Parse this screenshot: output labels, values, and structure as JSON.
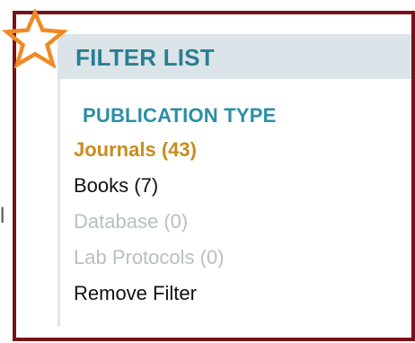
{
  "edge_glyph": "l",
  "filter_panel": {
    "title": "FILTER LIST",
    "section_heading": "PUBLICATION TYPE",
    "options": [
      {
        "label": "Journals",
        "count": "(43)",
        "state": "active"
      },
      {
        "label": "Books",
        "count": "(7)",
        "state": "normal"
      },
      {
        "label": "Database",
        "count": "(0)",
        "state": "disabled"
      },
      {
        "label": "Lab Protocols",
        "count": "(0)",
        "state": "disabled"
      }
    ],
    "remove_filter_label": "Remove Filter"
  },
  "icons": {
    "star": "star-outline-icon"
  },
  "colors": {
    "frame_border": "#7a1118",
    "header_background": "#dbe4e8",
    "header_text": "#2a7e93",
    "section_text": "#2a8fa6",
    "active_option": "#c98c1e",
    "disabled_option": "#b9bfc2",
    "star_outline": "#f08a24"
  }
}
